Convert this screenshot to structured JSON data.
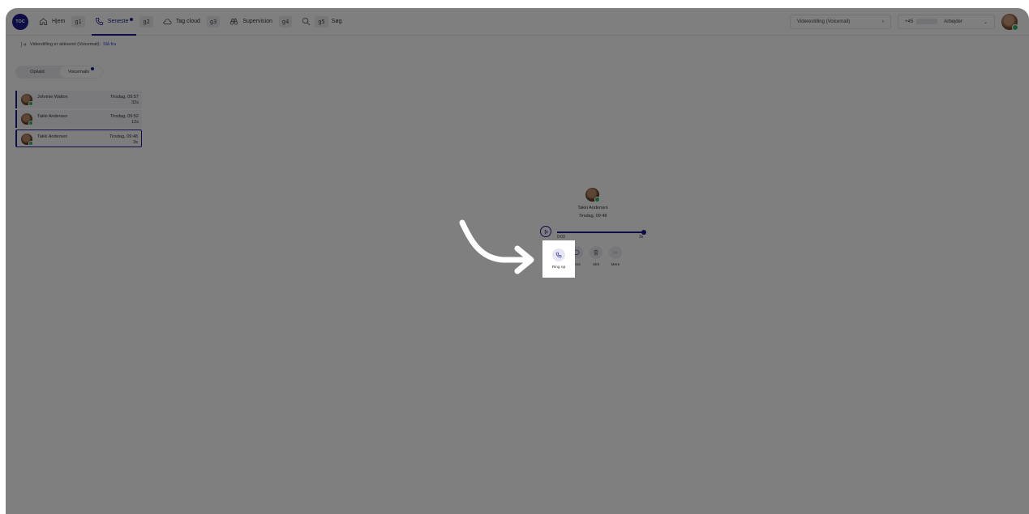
{
  "header": {
    "logo_text": "TOC",
    "nav": [
      {
        "label": "Hjem",
        "key": "g1"
      },
      {
        "label": "Seneste",
        "key": "g2",
        "active": true
      },
      {
        "label": "Tag cloud",
        "key": "g3"
      },
      {
        "label": "Supervision",
        "key": "g4"
      },
      {
        "label": "Søg",
        "key": "g5"
      }
    ],
    "forwarding_select": "Viderestilling (Voicemail)",
    "phone_prefix": "+45",
    "status_select": "Arbejder"
  },
  "info": {
    "text": "Viderstilling er aktiveret (Voicemail):",
    "link": "Slå fra"
  },
  "tabs": {
    "calls": "Opkald",
    "voicemails": "Voicemails"
  },
  "voicemails": [
    {
      "name": "Johnnie Walton",
      "time": "Tirsdag, 09:57",
      "duration": "32s"
    },
    {
      "name": "Takki Andersen",
      "time": "Tirsdag, 09:52",
      "duration": "12s"
    },
    {
      "name": "Takki Andersen",
      "time": "Tirsdag, 09:48",
      "duration": "3s",
      "selected": true
    }
  ],
  "detail": {
    "name": "Takki Andersen",
    "time": "Tirsdag, 09:48",
    "progress_start": "0:03",
    "progress_end": "3s",
    "progress_fraction": 1.0,
    "actions": {
      "call": "Ring op",
      "sms": "Sms",
      "delete": "Slet",
      "more": "Mere"
    }
  },
  "colors": {
    "accent": "#1d1a8c",
    "link": "#2b3fd6",
    "online": "#2fb463",
    "overlay": "rgba(0,0,0,0.5)"
  }
}
